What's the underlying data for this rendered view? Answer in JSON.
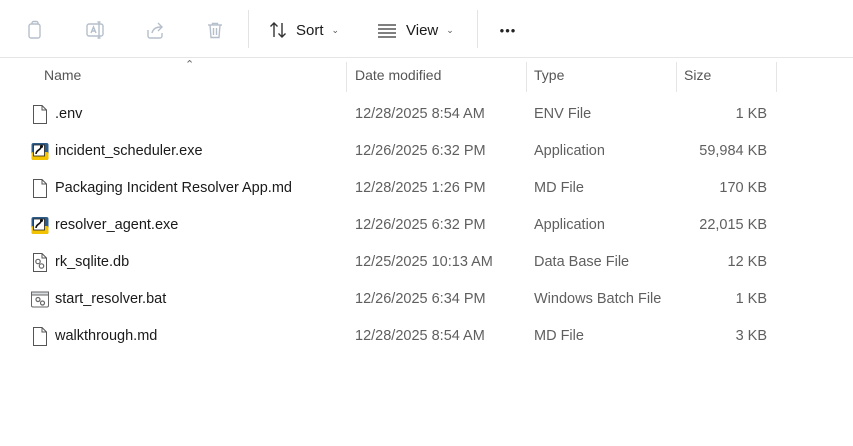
{
  "toolbar": {
    "sort_label": "Sort",
    "view_label": "View",
    "more_label": "•••",
    "icons": [
      "copy-icon",
      "rename-icon",
      "share-icon",
      "delete-icon",
      "sort-icon",
      "view-icon",
      "chevron-down-icon",
      "more-icon"
    ]
  },
  "columns": {
    "name": "Name",
    "date": "Date modified",
    "type": "Type",
    "size": "Size"
  },
  "files": [
    {
      "name": ".env",
      "date": "12/28/2025 8:54 AM",
      "type": "ENV File",
      "size": "1 KB",
      "icon": "document-icon"
    },
    {
      "name": "incident_scheduler.exe",
      "date": "12/26/2025 6:32 PM",
      "type": "Application",
      "size": "59,984 KB",
      "icon": "python-exe-icon"
    },
    {
      "name": "Packaging Incident Resolver App.md",
      "date": "12/28/2025 1:26 PM",
      "type": "MD File",
      "size": "170 KB",
      "icon": "document-icon"
    },
    {
      "name": "resolver_agent.exe",
      "date": "12/26/2025 6:32 PM",
      "type": "Application",
      "size": "22,015 KB",
      "icon": "python-exe-icon"
    },
    {
      "name": "rk_sqlite.db",
      "date": "12/25/2025 10:13 AM",
      "type": "Data Base File",
      "size": "12 KB",
      "icon": "settings-file-icon"
    },
    {
      "name": "start_resolver.bat",
      "date": "12/26/2025 6:34 PM",
      "type": "Windows Batch File",
      "size": "1 KB",
      "icon": "batch-file-icon"
    },
    {
      "name": "walkthrough.md",
      "date": "12/28/2025 8:54 AM",
      "type": "MD File",
      "size": "3 KB",
      "icon": "document-icon"
    }
  ]
}
